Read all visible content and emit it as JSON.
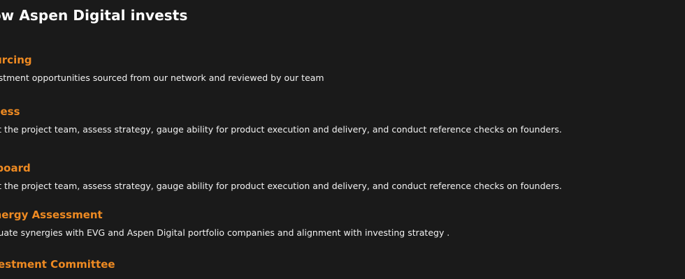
{
  "section": {
    "title": "How Aspen Digital invests"
  },
  "steps": [
    {
      "title": "Sourcing",
      "description": "Investment opportunities sourced from our network and reviewed by our team"
    },
    {
      "title": "Assess",
      "description": "Meet the project team, assess strategy, gauge ability for product execution and delivery, and conduct reference checks on founders."
    },
    {
      "title": "Onboard",
      "description": "Meet the project team, assess strategy, gauge ability for product execution and delivery, and conduct reference checks on founders."
    },
    {
      "title": "Synergy Assessment",
      "description": "Evaluate synergies with EVG and Aspen Digital portfolio companies and alignment with investing strategy ."
    },
    {
      "title": "Investment Committee",
      "description": ""
    }
  ]
}
